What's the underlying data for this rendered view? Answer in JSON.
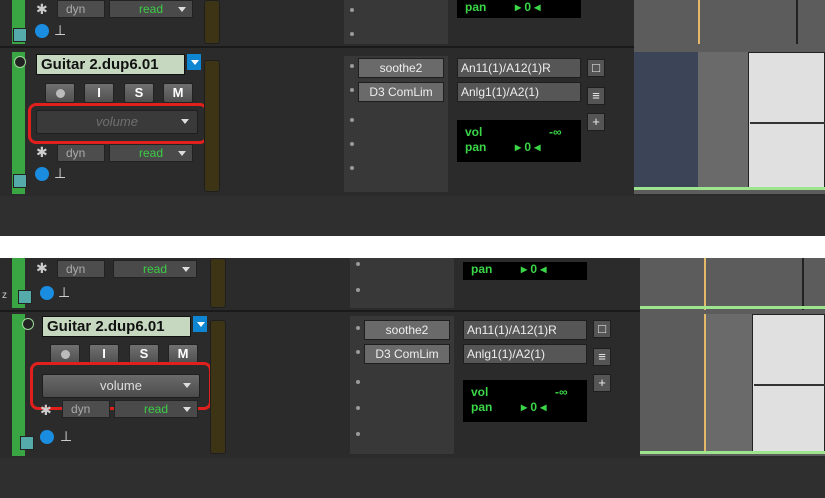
{
  "track": {
    "name": "Guitar 2.dup6.01",
    "buttons": {
      "record_symbol": "●",
      "input": "I",
      "solo": "S",
      "mute": "M"
    },
    "automation": {
      "view_before": "volume",
      "view_after": "volume",
      "dyn_label": "dyn",
      "mode": "read",
      "asterisk": "✱"
    },
    "inserts": [
      "soothe2",
      "D3 ComLim"
    ],
    "io": {
      "input": "An11(1)/A12(1)R",
      "output": "Anlg1(1)/A2(1)"
    },
    "mix": {
      "vol_label": "vol",
      "vol_value": "-∞",
      "pan_label": "pan",
      "pan_value": "0"
    }
  },
  "colors": {
    "track_green": "#3aa543",
    "highlight": "#e0201c",
    "meter_green": "#3bd648",
    "cursor": "#e6b96a"
  },
  "icons": {
    "add": "+",
    "ioview": "□",
    "list": "≡",
    "mono": "⊥"
  }
}
